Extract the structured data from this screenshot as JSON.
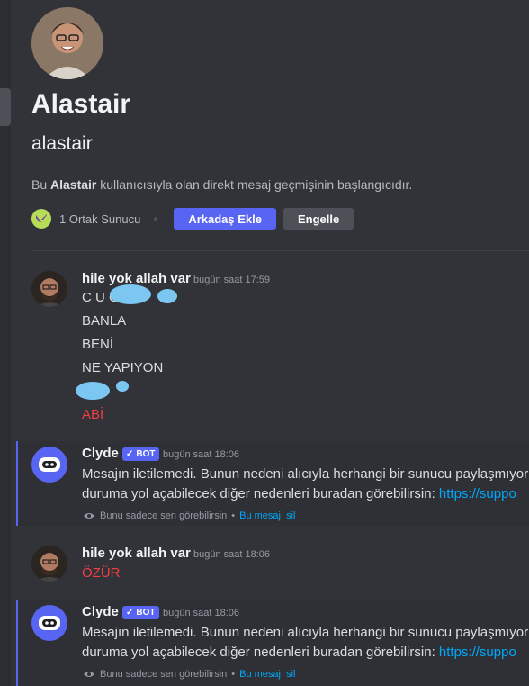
{
  "profile": {
    "display_name": "Alastair",
    "username": "alastair",
    "intro_prefix": "Bu",
    "intro_name": "Alastair",
    "intro_suffix": "kullanıcısıyla olan direkt mesaj geçmişinin başlangıcıdır.",
    "mutual_servers": "1 Ortak Sunucu",
    "add_friend_label": "Arkadaş Ekle",
    "block_label": "Engelle"
  },
  "messages": [
    {
      "author": "hile yok allah var",
      "timestamp": "bugün saat 17:59",
      "lines": [
        "C      U CUCU",
        "BANLA",
        "BENİ",
        "NE  YAPIYON",
        "     CI",
        "ABİ"
      ]
    },
    {
      "author": "Clyde",
      "badge": "BOT",
      "timestamp": "bugün saat 18:06",
      "text_line1": "Mesajın iletilemedi. Bunun nedeni alıcıyla herhangi bir sunucu paylaşmıyor",
      "text_line2": "duruma yol açabilecek diğer nedenleri buradan görebilirsin: ",
      "link_text": "https://suppo",
      "note": "Bunu sadece sen görebilirsin",
      "note_sep": "•",
      "delete_label": "Bu mesajı sil"
    },
    {
      "author": "hile yok allah var",
      "timestamp": "bugün saat 18:06",
      "lines": [
        "ÖZÜR"
      ]
    },
    {
      "author": "Clyde",
      "badge": "BOT",
      "timestamp": "bugün saat 18:06",
      "text_line1": "Mesajın iletilemedi. Bunun nedeni alıcıyla herhangi bir sunucu paylaşmıyor",
      "text_line2": "duruma yol açabilecek diğer nedenleri buradan görebilirsin: ",
      "link_text": "https://suppo",
      "note": "Bunu sadece sen görebilirsin",
      "note_sep": "•",
      "delete_label": "Bu mesajı sil"
    }
  ],
  "icons": {
    "server": "valorant-icon",
    "verified": "checkmark-icon",
    "eye": "eye-icon",
    "clyde": "clyde-robot-icon"
  },
  "colors": {
    "background": "#313338",
    "accent": "#5865f2",
    "link": "#00a8fc",
    "red_text": "#f23f43",
    "server_icon": "#b6dc58"
  }
}
